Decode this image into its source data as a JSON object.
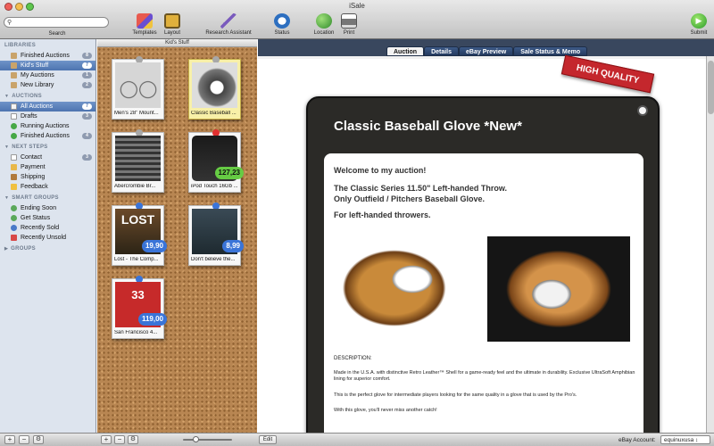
{
  "window": {
    "title": "iSale"
  },
  "toolbar": {
    "search_placeholder": "",
    "search_label": "Search",
    "templates": "Templates",
    "layout": "Layout",
    "research": "Research Assistant",
    "status": "Status",
    "location": "Location",
    "print": "Print",
    "submit": "Submit"
  },
  "sidebar": {
    "libraries": "LIBRARIES",
    "finished_auctions": "Finished Auctions",
    "finished_auctions_count": "8",
    "kids_stuff": "Kid's Stuff",
    "kids_stuff_count": "7",
    "my_auctions": "My Auctions",
    "my_auctions_count": "1",
    "new_library": "New Library",
    "new_library_count": "2",
    "auctions": "AUCTIONS",
    "all_auctions": "All Auctions",
    "all_auctions_count": "7",
    "drafts": "Drafts",
    "drafts_count": "3",
    "running_auctions": "Running Auctions",
    "finished_auctions2": "Finished Auctions",
    "finished_auctions2_count": "4",
    "next_steps": "NEXT STEPS",
    "contact": "Contact",
    "contact_count": "3",
    "payment": "Payment",
    "shipping": "Shipping",
    "feedback": "Feedback",
    "smart_groups": "SMART GROUPS",
    "ending_soon": "Ending Soon",
    "get_status": "Get Status",
    "recently_sold": "Recently Sold",
    "recently_unsold": "Recently Unsold",
    "groups": "GROUPS"
  },
  "corkboard": {
    "title": "Kid's Stuff",
    "items": [
      {
        "label": "Men's 28\" Mount...",
        "price": ""
      },
      {
        "label": "Classic Baseball ...",
        "price": ""
      },
      {
        "label": "Abercrombie Br...",
        "price": ""
      },
      {
        "label": "iPod Touch 16Gb ...",
        "price": "127,23"
      },
      {
        "label": "Lost - The Comp...",
        "price": "19,90"
      },
      {
        "label": "Don't believe the...",
        "price": "8,99"
      },
      {
        "label": "San Francisco 4...",
        "price": "119,00"
      }
    ],
    "lost_poster_text": "LOST",
    "jersey_number": "33"
  },
  "tabs": [
    "Auction",
    "Details",
    "eBay Preview",
    "Sale Status & Memo"
  ],
  "listing": {
    "badge": "HIGH QUALITY",
    "title": "Classic Baseball Glove *New*",
    "welcome": "Welcome to my auction!",
    "line1": "The Classic Series 11.50\" Left-handed Throw.",
    "line2": "Only Outfield / Pitchers Baseball Glove.",
    "line3": "For left-handed throwers.",
    "desc_heading": "DESCRIPTION:",
    "desc1": "Made in the U.S.A. with distinctive Retro Leather™ Shell for a game-ready feel and the ultimate in durability. Exclusive UltraSoft Amphibian lining for superior comfort.",
    "desc2": "This is the perfect glove for intermediate players looking for the same quality in a glove that is used by the Pro's.",
    "desc3": "With this glove, you'll never miss another catch!"
  },
  "bottom": {
    "add": "+",
    "remove": "−",
    "gear": "⚙",
    "edit": "Edit",
    "ebay_label": "eBay Account:",
    "ebay_account": "equinuxusa ↕"
  },
  "colors": {
    "accent": "#4d74b0",
    "main_bg": "#39475e",
    "cork": "#b88652",
    "badge": "#c4272d"
  }
}
